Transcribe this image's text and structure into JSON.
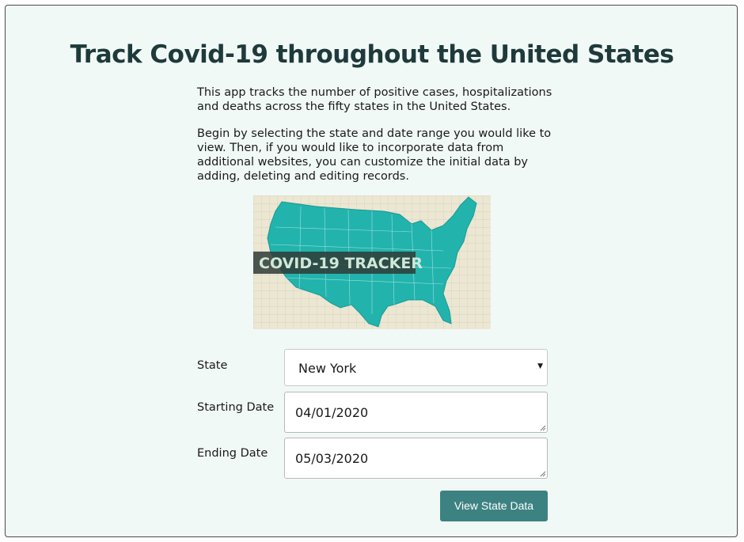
{
  "page": {
    "title": "Track Covid-19 throughout the United States",
    "intro_paragraphs": [
      "This app tracks the number of positive cases, hospitalizations and deaths across the fifty states in the United States.",
      "Begin by selecting the state and date range you would like to view. Then, if you would like to incorporate data from additional websites, you can customize the initial data by adding, deleting and editing records."
    ]
  },
  "banner": {
    "text": "COVID-19 TRACKER",
    "map_color": "#22b3ad",
    "paper_color": "#ece7d3"
  },
  "form": {
    "state_label": "State",
    "state_value": "New York",
    "start_label": "Starting Date",
    "start_value": "04/01/2020",
    "end_label": "Ending Date",
    "end_value": "05/03/2020",
    "submit_label": "View State Data"
  },
  "colors": {
    "background": "#f1f9f7",
    "title": "#1e3a3a",
    "button": "#3d8282"
  }
}
